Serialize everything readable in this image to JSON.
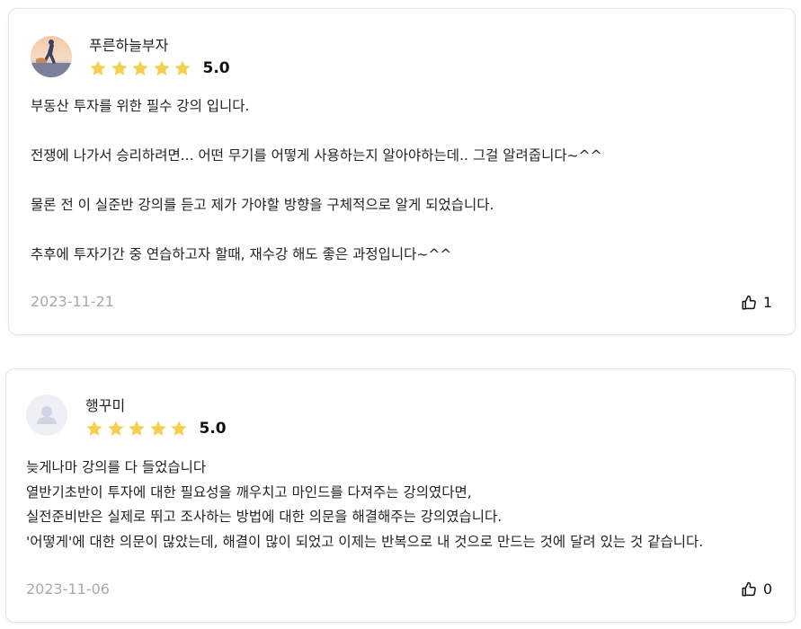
{
  "reviews": [
    {
      "username": "푸른하늘부자",
      "score": "5.0",
      "stars": 5,
      "lines": [
        "부동산 투자를 위한 필수 강의 입니다.",
        "전쟁에 나가서 승리하려면... 어떤 무기를 어떻게 사용하는지 알아야하는데.. 그걸 알려줍니다~^^",
        "물론 전 이 실준반 강의를 듣고 제가 가야할 방향을 구체적으로 알게 되었습니다.",
        "추후에 투자기간 중 연습하고자 할때, 재수강 해도 좋은 과정입니다~^^"
      ],
      "date": "2023-11-21",
      "likes": "1"
    },
    {
      "username": "행꾸미",
      "score": "5.0",
      "stars": 5,
      "lines": [
        "늦게나마 강의를 다 들었습니다",
        "열반기초반이 투자에 대한 필요성을 깨우치고 마인드를 다져주는 강의였다면,",
        "실전준비반은 실제로 뛰고 조사하는 방법에 대한 의문을 해결해주는 강의였습니다.",
        "'어떻게'에 대한 의문이 많았는데, 해결이 많이 되었고 이제는 반복으로 내 것으로 만드는 것에 달려 있는 것 같습니다."
      ],
      "date": "2023-11-06",
      "likes": "0"
    }
  ],
  "colors": {
    "star": "#f5d04e",
    "date": "#a9a9a9",
    "border": "#e6e6e6"
  }
}
